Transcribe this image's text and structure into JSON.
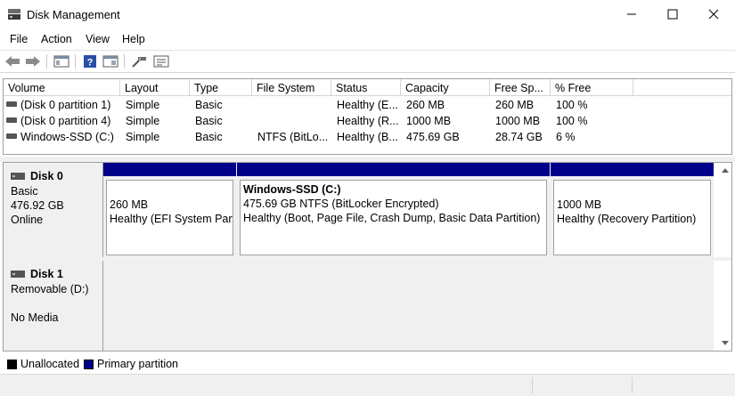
{
  "window": {
    "title": "Disk Management"
  },
  "menu": [
    "File",
    "Action",
    "View",
    "Help"
  ],
  "toolbar": {
    "icons": [
      "back-icon",
      "forward-icon",
      "console-tree-icon",
      "help-icon",
      "properties-icon",
      "connect-icon",
      "rescan-icon"
    ]
  },
  "volume_list": {
    "columns": [
      "Volume",
      "Layout",
      "Type",
      "File System",
      "Status",
      "Capacity",
      "Free Sp...",
      "% Free"
    ],
    "rows": [
      [
        "(Disk 0 partition 1)",
        "Simple",
        "Basic",
        "",
        "Healthy (E...",
        "260 MB",
        "260 MB",
        "100 %"
      ],
      [
        "(Disk 0 partition 4)",
        "Simple",
        "Basic",
        "",
        "Healthy (R...",
        "1000 MB",
        "1000 MB",
        "100 %"
      ],
      [
        "Windows-SSD (C:)",
        "Simple",
        "Basic",
        "NTFS (BitLo...",
        "Healthy (B...",
        "475.69 GB",
        "28.74 GB",
        "6 %"
      ]
    ]
  },
  "disks": [
    {
      "name": "Disk 0",
      "type": "Basic",
      "size": "476.92 GB",
      "state": "Online",
      "partitions": [
        {
          "name": "",
          "size": "260 MB",
          "status": "Healthy (EFI System Part"
        },
        {
          "name": "Windows-SSD  (C:)",
          "size": "475.69 GB NTFS (BitLocker Encrypted)",
          "status": "Healthy (Boot, Page File, Crash Dump, Basic Data Partition)"
        },
        {
          "name": "",
          "size": "1000 MB",
          "status": "Healthy (Recovery Partition)"
        }
      ]
    },
    {
      "name": "Disk 1",
      "type": "Removable (D:)",
      "size": "",
      "state": "No Media"
    }
  ],
  "legend": [
    {
      "label": "Unallocated",
      "color": "#000000"
    },
    {
      "label": "Primary partition",
      "color": "#00008b"
    }
  ],
  "colors": {
    "primary_partition": "#00008b",
    "unallocated": "#000000",
    "panel_bg": "#f0f0f0"
  }
}
